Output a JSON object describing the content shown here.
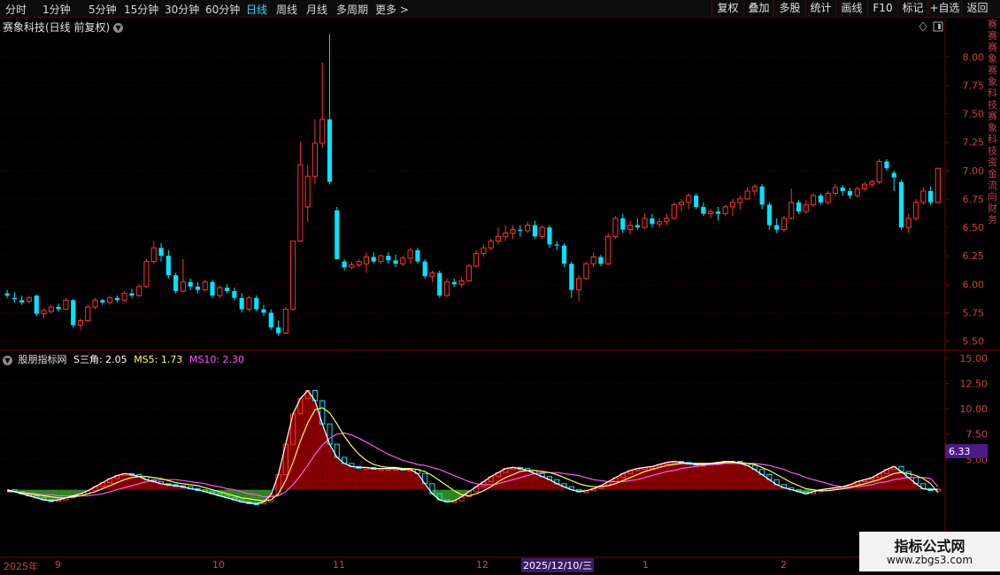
{
  "toolbar": {
    "periods": [
      "分时",
      "1分钟",
      "5分钟",
      "15分钟",
      "30分钟",
      "60分钟",
      "日线",
      "周线",
      "月线",
      "多周期",
      "更多 >"
    ],
    "active_period": "日线",
    "right_buttons": [
      "复权",
      "叠加",
      "多股",
      "统计",
      "画线",
      "F10",
      "标记",
      "+自选",
      "返回"
    ]
  },
  "main": {
    "stock_title": "赛象科技(日线 前复权)",
    "price_ticks": [
      "8.00",
      "7.75",
      "7.50",
      "7.25",
      "7.00",
      "6.75",
      "6.50",
      "6.25",
      "6.00",
      "5.75",
      "5.50"
    ],
    "side_text": "赛赛赛象赛象科技赛象科技资金流向财务"
  },
  "indicator": {
    "name": "股朋指标网",
    "s_label": "S三角: 2.05",
    "ms5_label": "MS5: 1.73",
    "ms10_label": "MS10: 2.30",
    "current_value": "6.33",
    "ticks": [
      "15.00",
      "12.50",
      "10.00",
      "7.50",
      "5.00"
    ]
  },
  "dates": {
    "labels": [
      "2025年",
      "9",
      "10",
      "11",
      "12",
      "1",
      "2"
    ],
    "highlighted": "2025/12/10/三"
  },
  "watermark": {
    "line1": "指标公式网",
    "line2": "www.zbgs3.com"
  },
  "colors": {
    "up": "#ff3232",
    "down": "#00e5ff",
    "ma5": "#ffff55",
    "ma10": "#ff55ff",
    "s": "#ffffff",
    "grid": "#3c0000",
    "axis": "#7a0000"
  },
  "chart_data": {
    "type": "candlestick",
    "y_range": [
      5.45,
      8.22
    ],
    "candles_ohlc": [
      [
        5.92,
        5.95,
        5.88,
        5.9
      ],
      [
        5.88,
        5.93,
        5.84,
        5.87
      ],
      [
        5.86,
        5.9,
        5.82,
        5.84
      ],
      [
        5.85,
        5.9,
        5.83,
        5.88
      ],
      [
        5.9,
        5.91,
        5.72,
        5.74
      ],
      [
        5.74,
        5.79,
        5.7,
        5.77
      ],
      [
        5.76,
        5.82,
        5.74,
        5.8
      ],
      [
        5.8,
        5.83,
        5.76,
        5.78
      ],
      [
        5.78,
        5.88,
        5.77,
        5.86
      ],
      [
        5.86,
        5.87,
        5.62,
        5.64
      ],
      [
        5.64,
        5.7,
        5.6,
        5.68
      ],
      [
        5.68,
        5.82,
        5.67,
        5.8
      ],
      [
        5.8,
        5.88,
        5.78,
        5.86
      ],
      [
        5.86,
        5.87,
        5.82,
        5.84
      ],
      [
        5.84,
        5.9,
        5.82,
        5.88
      ],
      [
        5.88,
        5.9,
        5.84,
        5.86
      ],
      [
        5.86,
        5.94,
        5.85,
        5.92
      ],
      [
        5.92,
        5.96,
        5.88,
        5.9
      ],
      [
        5.9,
        6.0,
        5.89,
        5.98
      ],
      [
        5.98,
        6.22,
        5.97,
        6.2
      ],
      [
        6.2,
        6.38,
        6.18,
        6.32
      ],
      [
        6.32,
        6.36,
        6.2,
        6.25
      ],
      [
        6.25,
        6.3,
        6.05,
        6.08
      ],
      [
        6.08,
        6.1,
        5.92,
        5.94
      ],
      [
        5.94,
        6.22,
        5.93,
        6.02
      ],
      [
        6.02,
        6.05,
        5.95,
        5.98
      ],
      [
        5.98,
        6.02,
        5.92,
        5.95
      ],
      [
        5.95,
        6.04,
        5.94,
        6.02
      ],
      [
        6.02,
        6.04,
        5.88,
        5.9
      ],
      [
        5.9,
        5.99,
        5.88,
        5.97
      ],
      [
        5.97,
        6.0,
        5.92,
        5.94
      ],
      [
        5.94,
        5.97,
        5.86,
        5.88
      ],
      [
        5.88,
        5.92,
        5.75,
        5.78
      ],
      [
        5.78,
        5.9,
        5.76,
        5.88
      ],
      [
        5.88,
        5.9,
        5.76,
        5.78
      ],
      [
        5.78,
        5.82,
        5.72,
        5.75
      ],
      [
        5.75,
        5.78,
        5.6,
        5.62
      ],
      [
        5.62,
        5.68,
        5.55,
        5.57
      ],
      [
        5.57,
        5.8,
        5.56,
        5.78
      ],
      [
        5.78,
        6.38,
        5.77,
        6.38
      ],
      [
        6.38,
        7.25,
        6.37,
        7.05
      ],
      [
        6.68,
        7.05,
        6.55,
        6.95
      ],
      [
        6.95,
        7.45,
        6.88,
        7.24
      ],
      [
        7.24,
        7.95,
        7.2,
        7.45
      ],
      [
        7.45,
        8.2,
        6.88,
        6.9
      ],
      [
        6.65,
        6.68,
        6.22,
        6.22
      ],
      [
        6.2,
        6.22,
        6.12,
        6.15
      ],
      [
        6.15,
        6.2,
        6.13,
        6.17
      ],
      [
        6.17,
        6.22,
        6.15,
        6.2
      ],
      [
        6.18,
        6.28,
        6.1,
        6.24
      ],
      [
        6.24,
        6.28,
        6.18,
        6.2
      ],
      [
        6.2,
        6.26,
        6.18,
        6.25
      ],
      [
        6.25,
        6.28,
        6.18,
        6.21
      ],
      [
        6.21,
        6.26,
        6.15,
        6.18
      ],
      [
        6.18,
        6.25,
        6.16,
        6.23
      ],
      [
        6.23,
        6.32,
        6.18,
        6.3
      ],
      [
        6.3,
        6.32,
        6.18,
        6.2
      ],
      [
        6.2,
        6.22,
        6.05,
        6.07
      ],
      [
        6.07,
        6.12,
        6.02,
        6.1
      ],
      [
        6.1,
        6.12,
        5.88,
        5.9
      ],
      [
        5.9,
        6.05,
        5.89,
        6.02
      ],
      [
        6.02,
        6.05,
        5.98,
        6.0
      ],
      [
        6.0,
        6.06,
        5.97,
        6.03
      ],
      [
        6.03,
        6.18,
        6.02,
        6.16
      ],
      [
        6.16,
        6.3,
        6.15,
        6.27
      ],
      [
        6.27,
        6.35,
        6.24,
        6.32
      ],
      [
        6.32,
        6.4,
        6.3,
        6.38
      ],
      [
        6.38,
        6.5,
        6.35,
        6.42
      ],
      [
        6.42,
        6.52,
        6.38,
        6.45
      ],
      [
        6.45,
        6.52,
        6.4,
        6.48
      ],
      [
        6.48,
        6.52,
        6.42,
        6.47
      ],
      [
        6.47,
        6.55,
        6.45,
        6.52
      ],
      [
        6.52,
        6.56,
        6.4,
        6.42
      ],
      [
        6.42,
        6.52,
        6.4,
        6.5
      ],
      [
        6.5,
        6.52,
        6.32,
        6.35
      ],
      [
        6.35,
        6.38,
        6.3,
        6.34
      ],
      [
        6.34,
        6.36,
        6.15,
        6.18
      ],
      [
        6.18,
        6.2,
        5.88,
        5.95
      ],
      [
        5.95,
        6.08,
        5.85,
        6.05
      ],
      [
        6.05,
        6.2,
        6.04,
        6.18
      ],
      [
        6.18,
        6.28,
        6.15,
        6.24
      ],
      [
        6.24,
        6.26,
        6.16,
        6.18
      ],
      [
        6.18,
        6.45,
        6.17,
        6.42
      ],
      [
        6.42,
        6.6,
        6.4,
        6.58
      ],
      [
        6.58,
        6.62,
        6.45,
        6.48
      ],
      [
        6.48,
        6.56,
        6.44,
        6.52
      ],
      [
        6.52,
        6.58,
        6.48,
        6.5
      ],
      [
        6.5,
        6.62,
        6.49,
        6.58
      ],
      [
        6.58,
        6.62,
        6.5,
        6.53
      ],
      [
        6.53,
        6.58,
        6.5,
        6.55
      ],
      [
        6.55,
        6.62,
        6.52,
        6.58
      ],
      [
        6.58,
        6.72,
        6.57,
        6.7
      ],
      [
        6.7,
        6.75,
        6.64,
        6.72
      ],
      [
        6.72,
        6.8,
        6.66,
        6.78
      ],
      [
        6.78,
        6.8,
        6.66,
        6.68
      ],
      [
        6.68,
        6.72,
        6.6,
        6.62
      ],
      [
        6.62,
        6.66,
        6.58,
        6.64
      ],
      [
        6.64,
        6.68,
        6.56,
        6.62
      ],
      [
        6.62,
        6.7,
        6.6,
        6.68
      ],
      [
        6.68,
        6.75,
        6.6,
        6.72
      ],
      [
        6.72,
        6.78,
        6.66,
        6.75
      ],
      [
        6.75,
        6.85,
        6.74,
        6.82
      ],
      [
        6.82,
        6.88,
        6.78,
        6.86
      ],
      [
        6.86,
        6.88,
        6.66,
        6.7
      ],
      [
        6.7,
        6.72,
        6.48,
        6.52
      ],
      [
        6.52,
        6.58,
        6.45,
        6.48
      ],
      [
        6.48,
        6.6,
        6.46,
        6.58
      ],
      [
        6.58,
        6.84,
        6.57,
        6.72
      ],
      [
        6.72,
        6.74,
        6.62,
        6.64
      ],
      [
        6.64,
        6.74,
        6.62,
        6.7
      ],
      [
        6.7,
        6.8,
        6.68,
        6.78
      ],
      [
        6.78,
        6.8,
        6.7,
        6.72
      ],
      [
        6.72,
        6.82,
        6.7,
        6.8
      ],
      [
        6.8,
        6.88,
        6.78,
        6.85
      ],
      [
        6.85,
        6.87,
        6.78,
        6.82
      ],
      [
        6.82,
        6.85,
        6.75,
        6.78
      ],
      [
        6.78,
        6.86,
        6.76,
        6.84
      ],
      [
        6.84,
        6.9,
        6.82,
        6.88
      ],
      [
        6.88,
        6.92,
        6.85,
        6.9
      ],
      [
        6.9,
        7.1,
        6.88,
        7.08
      ],
      [
        7.08,
        7.1,
        7.0,
        7.02
      ],
      [
        6.98,
        7.0,
        6.82,
        6.94
      ],
      [
        6.9,
        6.92,
        6.48,
        6.5
      ],
      [
        6.5,
        6.62,
        6.45,
        6.58
      ],
      [
        6.58,
        6.75,
        6.56,
        6.72
      ],
      [
        6.72,
        6.85,
        6.7,
        6.82
      ],
      [
        6.82,
        6.86,
        6.7,
        6.72
      ],
      [
        6.72,
        7.02,
        6.71,
        7.02
      ]
    ],
    "s_values": [
      2.0,
      1.8,
      1.6,
      1.4,
      1.2,
      1.0,
      0.9,
      1.0,
      1.2,
      1.4,
      1.6,
      1.9,
      2.3,
      2.7,
      3.1,
      3.4,
      3.6,
      3.5,
      3.3,
      3.0,
      2.8,
      2.6,
      2.5,
      2.4,
      2.3,
      2.1,
      2.0,
      1.8,
      1.6,
      1.4,
      1.2,
      1.0,
      0.8,
      0.7,
      0.6,
      0.8,
      1.5,
      3.5,
      6.5,
      9.5,
      11.0,
      11.8,
      10.8,
      8.5,
      6.5,
      5.2,
      4.6,
      4.3,
      4.2,
      4.2,
      4.1,
      4.1,
      4.1,
      4.1,
      4.0,
      4.0,
      3.6,
      2.6,
      1.6,
      1.0,
      0.8,
      0.9,
      1.3,
      1.8,
      2.3,
      2.8,
      3.3,
      3.7,
      4.1,
      4.2,
      4.1,
      3.9,
      3.6,
      3.3,
      3.0,
      2.6,
      2.3,
      2.0,
      1.8,
      1.9,
      2.1,
      2.4,
      2.8,
      3.2,
      3.6,
      3.9,
      4.1,
      4.2,
      4.3,
      4.5,
      4.7,
      4.8,
      4.7,
      4.6,
      4.5,
      4.5,
      4.6,
      4.7,
      4.8,
      4.8,
      4.6,
      4.4,
      4.0,
      3.5,
      3.0,
      2.5,
      2.2,
      2.0,
      1.8,
      1.6,
      1.8,
      2.0,
      2.1,
      2.2,
      2.3,
      2.5,
      2.8,
      3.0,
      3.2,
      3.6,
      4.0,
      4.3,
      3.8,
      3.2,
      2.6,
      2.1,
      2.0,
      2.05
    ],
    "ms5_values": [
      1.9,
      1.8,
      1.7,
      1.6,
      1.5,
      1.4,
      1.3,
      1.2,
      1.2,
      1.3,
      1.4,
      1.6,
      1.8,
      2.1,
      2.4,
      2.7,
      3.0,
      3.2,
      3.3,
      3.3,
      3.2,
      3.1,
      2.9,
      2.7,
      2.6,
      2.5,
      2.4,
      2.2,
      2.0,
      1.8,
      1.6,
      1.4,
      1.2,
      1.1,
      1.0,
      0.9,
      1.0,
      1.6,
      2.9,
      4.7,
      6.8,
      8.6,
      9.9,
      10.1,
      9.6,
      8.5,
      7.3,
      6.3,
      5.5,
      4.9,
      4.5,
      4.3,
      4.2,
      4.2,
      4.1,
      4.1,
      4.0,
      3.8,
      3.4,
      2.9,
      2.4,
      1.9,
      1.5,
      1.4,
      1.6,
      1.9,
      2.3,
      2.8,
      3.2,
      3.5,
      3.8,
      3.9,
      3.9,
      3.8,
      3.7,
      3.5,
      3.2,
      2.9,
      2.6,
      2.4,
      2.3,
      2.3,
      2.4,
      2.6,
      2.9,
      3.2,
      3.5,
      3.8,
      4.0,
      4.2,
      4.4,
      4.5,
      4.6,
      4.6,
      4.6,
      4.6,
      4.6,
      4.6,
      4.7,
      4.7,
      4.7,
      4.6,
      4.5,
      4.2,
      3.9,
      3.5,
      3.1,
      2.7,
      2.4,
      2.1,
      2.0,
      1.9,
      1.9,
      2.0,
      2.1,
      2.2,
      2.4,
      2.6,
      2.8,
      3.0,
      3.3,
      3.6,
      3.7,
      3.6,
      3.4,
      3.1,
      2.6,
      1.73
    ],
    "ms10_values": [
      1.8,
      1.8,
      1.7,
      1.7,
      1.6,
      1.5,
      1.5,
      1.4,
      1.4,
      1.4,
      1.4,
      1.4,
      1.5,
      1.6,
      1.8,
      2.0,
      2.2,
      2.4,
      2.6,
      2.8,
      2.9,
      3.0,
      3.0,
      3.0,
      2.9,
      2.8,
      2.7,
      2.6,
      2.4,
      2.3,
      2.1,
      2.0,
      1.8,
      1.6,
      1.5,
      1.3,
      1.3,
      1.4,
      1.8,
      2.5,
      3.4,
      4.4,
      5.5,
      6.4,
      7.1,
      7.5,
      7.6,
      7.4,
      7.1,
      6.7,
      6.3,
      5.9,
      5.5,
      5.2,
      4.9,
      4.7,
      4.5,
      4.4,
      4.2,
      4.0,
      3.7,
      3.4,
      3.1,
      2.8,
      2.6,
      2.5,
      2.5,
      2.6,
      2.8,
      3.0,
      3.2,
      3.4,
      3.6,
      3.7,
      3.7,
      3.7,
      3.6,
      3.5,
      3.4,
      3.2,
      3.0,
      2.9,
      2.8,
      2.8,
      2.8,
      2.9,
      3.0,
      3.2,
      3.4,
      3.6,
      3.8,
      3.9,
      4.1,
      4.2,
      4.3,
      4.4,
      4.5,
      4.5,
      4.6,
      4.6,
      4.6,
      4.6,
      4.6,
      4.5,
      4.4,
      4.2,
      4.0,
      3.7,
      3.5,
      3.2,
      3.0,
      2.8,
      2.6,
      2.4,
      2.3,
      2.3,
      2.3,
      2.4,
      2.5,
      2.7,
      2.8,
      3.0,
      3.1,
      3.2,
      3.2,
      3.2,
      3.1,
      2.3
    ]
  }
}
